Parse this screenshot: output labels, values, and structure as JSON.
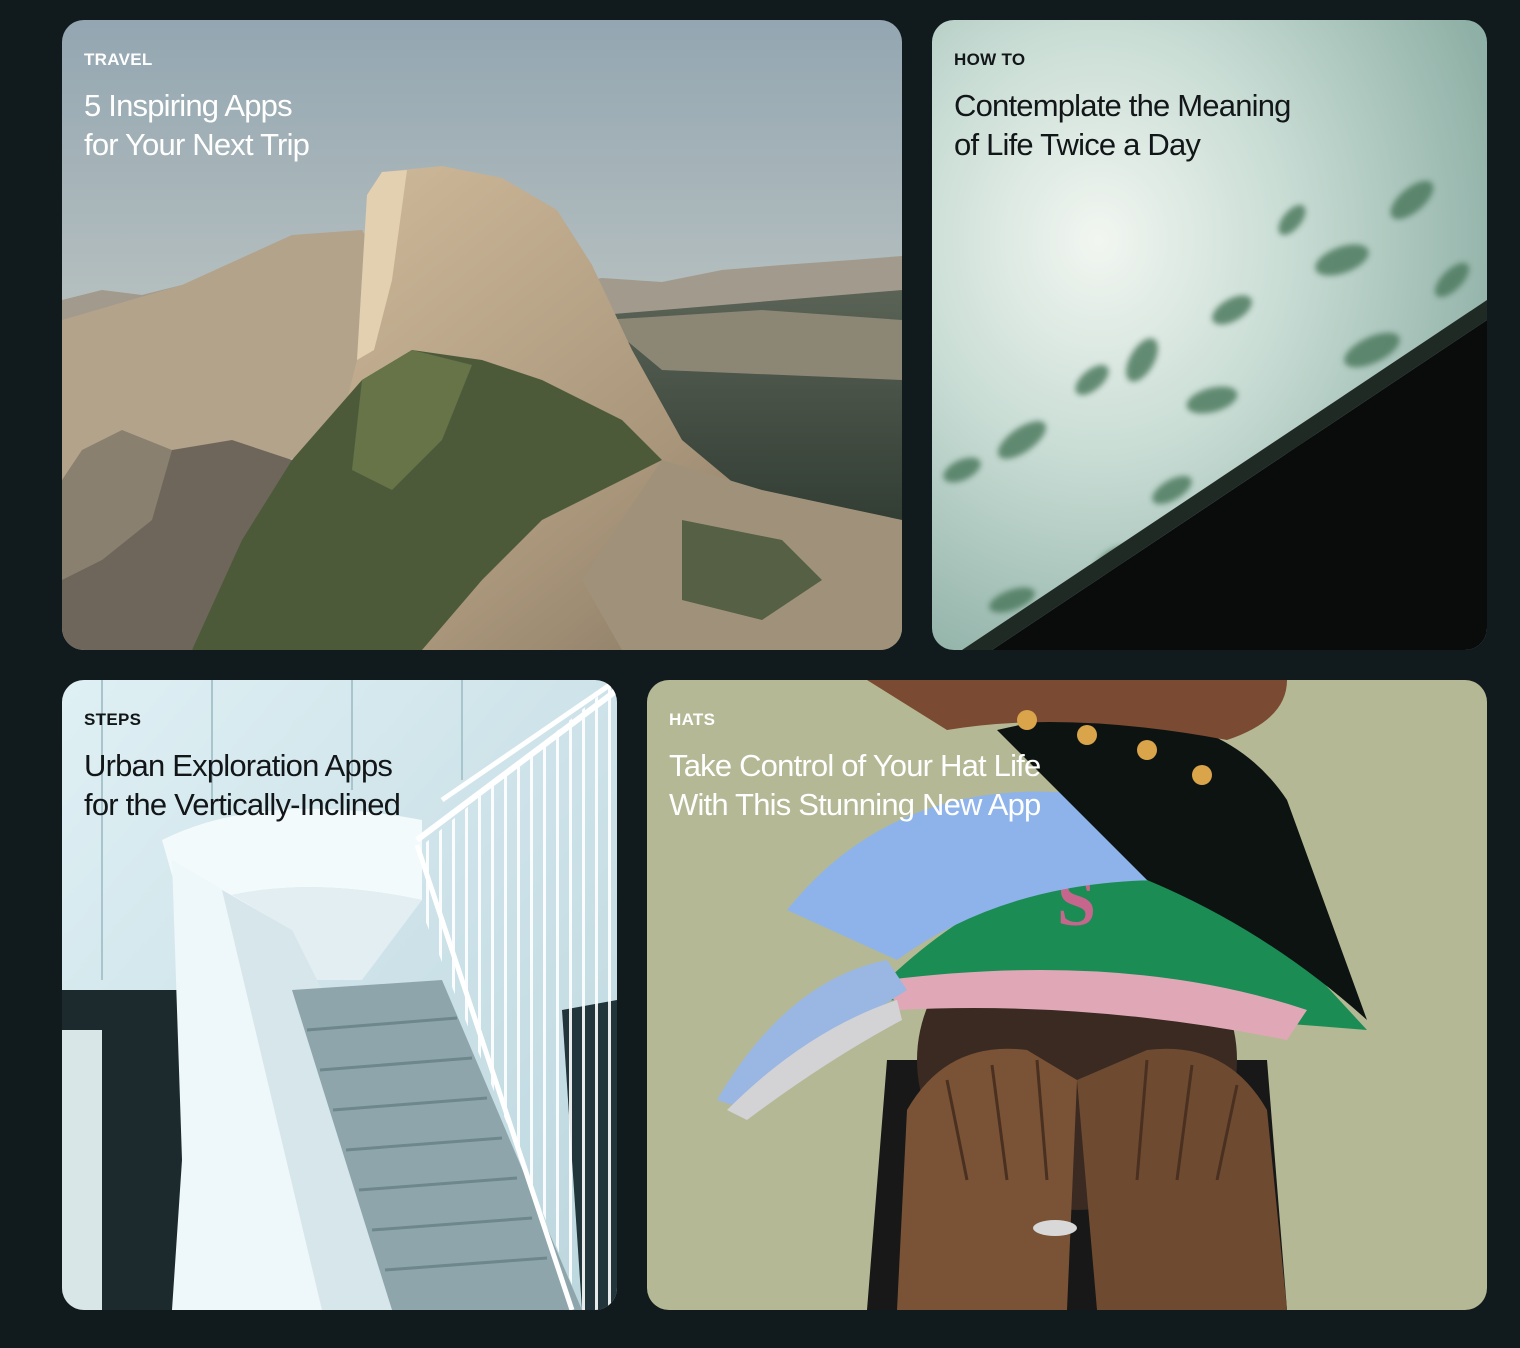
{
  "cards": [
    {
      "category": "TRAVEL",
      "title_line1": "5 Inspiring Apps",
      "title_line2": "for Your Next Trip",
      "image": "half-dome-mountain-photo"
    },
    {
      "category": "HOW TO",
      "title_line1": "Contemplate the Meaning",
      "title_line2": "of Life Twice a Day",
      "image": "leaves-shadow-window-photo"
    },
    {
      "category": "STEPS",
      "title_line1": "Urban Exploration Apps",
      "title_line2": "for the Vertically-Inclined",
      "image": "white-staircase-photo"
    },
    {
      "category": "HATS",
      "title_line1": "Take Control of Your Hat Life",
      "title_line2": "With This Stunning New App",
      "image": "stacked-caps-face-photo"
    }
  ],
  "colors": {
    "page_background": "#111a1d",
    "title_light": "#ffffff",
    "title_dark": "#121618"
  }
}
